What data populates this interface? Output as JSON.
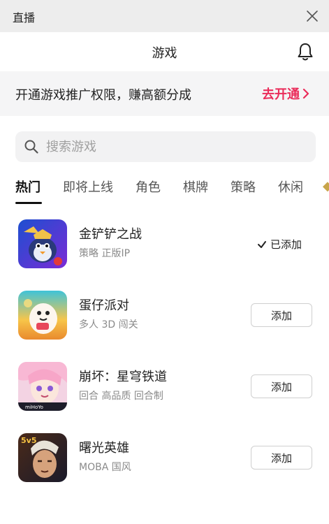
{
  "window": {
    "title": "直播"
  },
  "header": {
    "title": "游戏"
  },
  "promo": {
    "text": "开通游戏推广权限，赚高额分成",
    "action": "去开通"
  },
  "search": {
    "placeholder": "搜索游戏",
    "value": ""
  },
  "tabs": [
    {
      "label": "热门",
      "active": true
    },
    {
      "label": "即将上线"
    },
    {
      "label": "角色"
    },
    {
      "label": "棋牌"
    },
    {
      "label": "策略"
    },
    {
      "label": "休闲"
    }
  ],
  "games": [
    {
      "name": "金铲铲之战",
      "tags": "策略 正版IP",
      "status": "已添加"
    },
    {
      "name": "蛋仔派对",
      "tags": "多人 3D 闯关",
      "status": "添加"
    },
    {
      "name": "崩坏：星穹铁道",
      "tags": "回合 高品质 回合制",
      "status": "添加"
    },
    {
      "name": "曙光英雄",
      "tags": "MOBA 国风",
      "status": "添加"
    }
  ],
  "icons": {
    "close": "close-icon",
    "bell": "bell-icon",
    "chevron": "chevron-right-icon",
    "search": "search-icon",
    "check": "check-icon"
  },
  "colors": {
    "accent": "#ea2c5a",
    "titlebar": "#ededed",
    "promo_bg": "#f5f5f6"
  }
}
